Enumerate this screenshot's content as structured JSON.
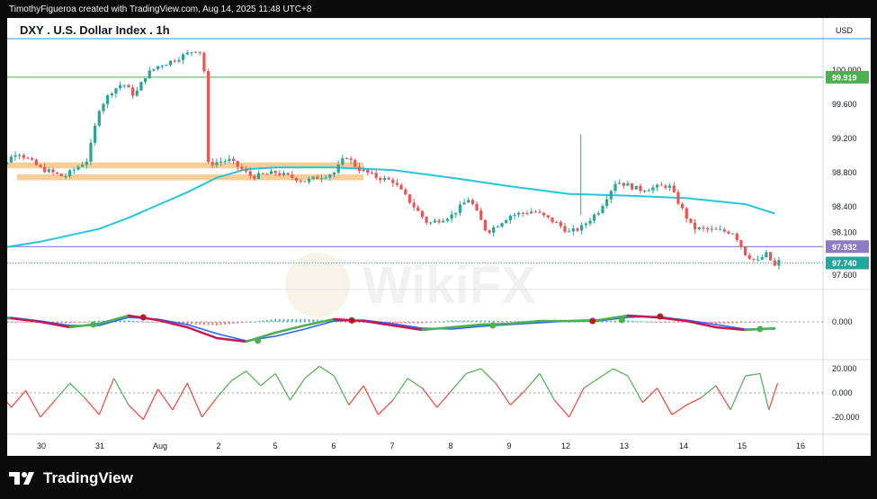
{
  "header": {
    "credit": "TimothyFigueroa created with TradingView.com, Aug 14, 2025 11:48 UTC+8",
    "symbol_title": "DXY . U.S. Dollar Index . 1h",
    "currency": "USD"
  },
  "footer": {
    "brand": "TradingView"
  },
  "watermark": "WikiFX",
  "colors": {
    "bull": "#26a69a",
    "bear": "#ef5350",
    "ma": "#26c6da",
    "zone": "#f7c98b",
    "level_green": "#4caf50",
    "level_purple": "#8e7cc3",
    "hline_blue": "#2196f3",
    "macd_fast": "#2962ff",
    "macd_slow": "#c2185b",
    "osc_up": "#4caf50",
    "osc_down": "#f44336"
  },
  "chart_data": [
    {
      "type": "candlestick",
      "title": "DXY . U.S. Dollar Index . 1h",
      "x_ticks": [
        "30",
        "31",
        "Aug",
        "2",
        "5",
        "6",
        "7",
        "8",
        "9",
        "12",
        "13",
        "14",
        "15",
        "16"
      ],
      "y_ticks": [
        "100.000",
        "99.600",
        "99.200",
        "98.800",
        "98.400",
        "98.100",
        "97.600"
      ],
      "ylim": [
        97.45,
        100.35
      ],
      "price_labels": [
        {
          "value": 99.919,
          "label": "99.919",
          "color": "#4caf50"
        },
        {
          "value": 97.932,
          "label": "97.932",
          "color": "#8e7cc3"
        },
        {
          "value": 97.74,
          "label": "97.740",
          "color": "#26a69a"
        }
      ],
      "horizontal_levels": [
        99.919,
        97.932
      ],
      "zones": [
        {
          "from_day": 29.0,
          "to_day": 35.5,
          "low": 98.85,
          "high": 98.92
        },
        {
          "from_day": 29.6,
          "to_day": 35.5,
          "low": 98.71,
          "high": 98.78
        }
      ],
      "moving_average": [
        [
          29.0,
          97.88
        ],
        [
          30.0,
          97.99
        ],
        [
          31.0,
          98.14
        ],
        [
          31.5,
          98.27
        ],
        [
          32.0,
          98.42
        ],
        [
          32.5,
          98.57
        ],
        [
          33.0,
          98.74
        ],
        [
          33.5,
          98.84
        ],
        [
          34.0,
          98.86
        ],
        [
          35.0,
          98.86
        ],
        [
          36.0,
          98.83
        ],
        [
          37.0,
          98.74
        ],
        [
          38.0,
          98.64
        ],
        [
          39.0,
          98.55
        ],
        [
          40.0,
          98.53
        ],
        [
          41.0,
          98.5
        ],
        [
          42.0,
          98.43
        ],
        [
          42.5,
          98.32
        ]
      ],
      "price_path": [
        [
          29.0,
          98.7
        ],
        [
          29.3,
          98.85
        ],
        [
          29.6,
          99.05
        ],
        [
          30.0,
          98.85
        ],
        [
          30.4,
          98.75
        ],
        [
          30.8,
          98.95
        ],
        [
          31.0,
          99.55
        ],
        [
          31.2,
          99.75
        ],
        [
          31.4,
          99.85
        ],
        [
          31.6,
          99.7
        ],
        [
          31.8,
          99.95
        ],
        [
          32.0,
          100.05
        ],
        [
          32.2,
          100.1
        ],
        [
          32.45,
          100.18
        ],
        [
          32.7,
          100.26
        ],
        [
          32.8,
          99.95
        ],
        [
          32.85,
          98.9
        ],
        [
          33.2,
          98.95
        ],
        [
          33.6,
          98.75
        ],
        [
          34.0,
          98.8
        ],
        [
          34.5,
          98.7
        ],
        [
          35.0,
          98.8
        ],
        [
          35.2,
          99.0
        ],
        [
          35.4,
          98.85
        ],
        [
          35.7,
          98.75
        ],
        [
          36.0,
          98.7
        ],
        [
          36.3,
          98.45
        ],
        [
          36.6,
          98.2
        ],
        [
          37.0,
          98.3
        ],
        [
          37.3,
          98.5
        ],
        [
          37.6,
          98.1
        ],
        [
          38.0,
          98.3
        ],
        [
          38.4,
          98.35
        ],
        [
          38.8,
          98.2
        ],
        [
          39.0,
          98.1
        ],
        [
          39.2,
          98.15
        ],
        [
          39.5,
          98.35
        ],
        [
          39.8,
          98.7
        ],
        [
          40.2,
          98.6
        ],
        [
          40.7,
          98.65
        ],
        [
          40.9,
          98.4
        ],
        [
          41.1,
          98.15
        ],
        [
          41.5,
          98.12
        ],
        [
          41.8,
          98.1
        ],
        [
          42.0,
          97.85
        ],
        [
          42.2,
          97.75
        ],
        [
          42.35,
          97.85
        ],
        [
          42.5,
          97.7
        ],
        [
          42.6,
          97.78
        ]
      ],
      "spike": {
        "day": 39.2,
        "high": 99.25,
        "low": 98.3
      }
    },
    {
      "type": "line",
      "title": "",
      "y_ticks": [
        "0.000"
      ],
      "series": [
        {
          "values": [
            [
              29.0,
              0.1
            ],
            [
              29.5,
              0.2
            ],
            [
              30.0,
              0.0
            ],
            [
              30.5,
              -0.3
            ],
            [
              31.0,
              -0.1
            ],
            [
              31.5,
              0.35
            ],
            [
              32.0,
              0.1
            ],
            [
              32.5,
              -0.3
            ],
            [
              33.0,
              -0.9
            ],
            [
              33.5,
              -1.1
            ],
            [
              34.0,
              -0.6
            ],
            [
              34.5,
              -0.2
            ],
            [
              35.0,
              0.15
            ],
            [
              35.5,
              0.05
            ],
            [
              36.0,
              -0.2
            ],
            [
              36.5,
              -0.45
            ],
            [
              37.0,
              -0.3
            ],
            [
              37.5,
              -0.15
            ],
            [
              38.0,
              -0.1
            ],
            [
              38.5,
              0.05
            ],
            [
              39.0,
              0.05
            ],
            [
              39.5,
              0.1
            ],
            [
              40.0,
              0.35
            ],
            [
              40.5,
              0.25
            ],
            [
              41.0,
              0.05
            ],
            [
              41.5,
              -0.3
            ],
            [
              42.0,
              -0.45
            ],
            [
              42.5,
              -0.35
            ]
          ]
        },
        {
          "values": [
            [
              29.0,
              0.2
            ],
            [
              29.5,
              0.25
            ],
            [
              30.0,
              0.05
            ],
            [
              30.5,
              -0.2
            ],
            [
              31.0,
              -0.2
            ],
            [
              31.5,
              0.25
            ],
            [
              32.0,
              0.15
            ],
            [
              32.5,
              -0.15
            ],
            [
              33.0,
              -0.65
            ],
            [
              33.5,
              -1.05
            ],
            [
              34.0,
              -0.8
            ],
            [
              34.5,
              -0.4
            ],
            [
              35.0,
              0.05
            ],
            [
              35.5,
              0.1
            ],
            [
              36.0,
              -0.1
            ],
            [
              36.5,
              -0.35
            ],
            [
              37.0,
              -0.4
            ],
            [
              37.5,
              -0.25
            ],
            [
              38.0,
              -0.15
            ],
            [
              38.5,
              -0.05
            ],
            [
              39.0,
              0.05
            ],
            [
              39.5,
              0.05
            ],
            [
              40.0,
              0.25
            ],
            [
              40.5,
              0.3
            ],
            [
              41.0,
              0.1
            ],
            [
              41.5,
              -0.15
            ],
            [
              42.0,
              -0.4
            ],
            [
              42.5,
              -0.4
            ]
          ]
        }
      ],
      "crossovers": [
        {
          "day": 29.25,
          "value": 0.22,
          "kind": "bear"
        },
        {
          "day": 30.9,
          "value": -0.15,
          "kind": "bull"
        },
        {
          "day": 31.75,
          "value": 0.25,
          "kind": "bear"
        },
        {
          "day": 33.7,
          "value": -1.05,
          "kind": "bull"
        },
        {
          "day": 35.3,
          "value": 0.08,
          "kind": "bear"
        },
        {
          "day": 37.7,
          "value": -0.2,
          "kind": "bull"
        },
        {
          "day": 39.4,
          "value": 0.05,
          "kind": "bear"
        },
        {
          "day": 39.9,
          "value": 0.1,
          "kind": "bull"
        },
        {
          "day": 40.55,
          "value": 0.3,
          "kind": "bear"
        },
        {
          "day": 42.25,
          "value": -0.4,
          "kind": "bull"
        }
      ]
    },
    {
      "type": "line",
      "title": "",
      "y_ticks": [
        "20.000",
        "0.000",
        "-20.000"
      ],
      "ylim": [
        -32,
        26
      ],
      "series": [
        {
          "values": [
            [
              29.0,
              -8
            ],
            [
              29.25,
              4
            ],
            [
              29.5,
              -12
            ],
            [
              29.75,
              2
            ],
            [
              30.0,
              -20
            ],
            [
              30.25,
              -6
            ],
            [
              30.5,
              8
            ],
            [
              30.75,
              -4
            ],
            [
              31.0,
              -18
            ],
            [
              31.25,
              12
            ],
            [
              31.5,
              -10
            ],
            [
              31.75,
              -22
            ],
            [
              32.0,
              3
            ],
            [
              32.25,
              -14
            ],
            [
              32.5,
              8
            ],
            [
              32.75,
              -20
            ],
            [
              33.0,
              -4
            ],
            [
              33.25,
              10
            ],
            [
              33.5,
              18
            ],
            [
              33.75,
              6
            ],
            [
              34.0,
              16
            ],
            [
              34.25,
              -6
            ],
            [
              34.5,
              12
            ],
            [
              34.75,
              22
            ],
            [
              35.0,
              14
            ],
            [
              35.25,
              -10
            ],
            [
              35.5,
              6
            ],
            [
              35.75,
              -18
            ],
            [
              36.0,
              -6
            ],
            [
              36.25,
              12
            ],
            [
              36.5,
              4
            ],
            [
              36.75,
              -12
            ],
            [
              37.0,
              2
            ],
            [
              37.25,
              16
            ],
            [
              37.5,
              20
            ],
            [
              37.75,
              8
            ],
            [
              38.0,
              -10
            ],
            [
              38.25,
              2
            ],
            [
              38.5,
              16
            ],
            [
              38.75,
              -6
            ],
            [
              39.0,
              -20
            ],
            [
              39.25,
              4
            ],
            [
              39.5,
              12
            ],
            [
              39.75,
              20
            ],
            [
              40.0,
              14
            ],
            [
              40.25,
              -8
            ],
            [
              40.5,
              4
            ],
            [
              40.75,
              -18
            ],
            [
              41.0,
              -10
            ],
            [
              41.25,
              -4
            ],
            [
              41.5,
              6
            ],
            [
              41.75,
              -14
            ],
            [
              42.0,
              14
            ],
            [
              42.25,
              16
            ],
            [
              42.4,
              -14
            ],
            [
              42.55,
              8
            ]
          ]
        }
      ]
    }
  ]
}
